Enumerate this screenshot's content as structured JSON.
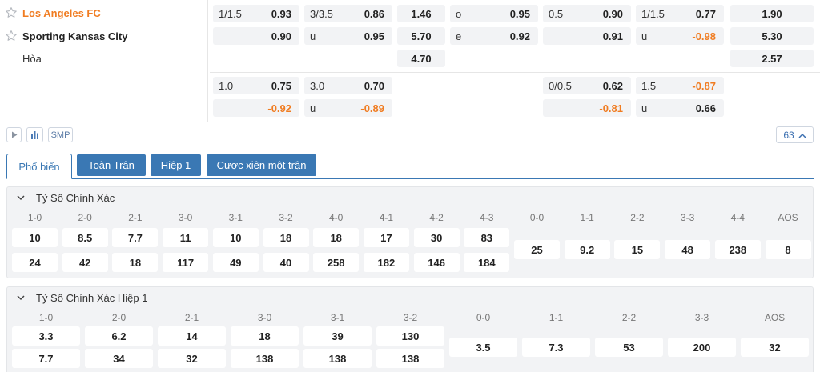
{
  "match": {
    "home": "Los Angeles FC",
    "away": "Sporting Kansas City",
    "draw": "Hòa"
  },
  "odds": {
    "ft_handicap": {
      "line": "1/1.5",
      "home": "0.93",
      "away": "0.90"
    },
    "ft_ou": {
      "line": "3/3.5",
      "over": "0.86",
      "under_label": "u",
      "under": "0.95"
    },
    "ft_1x2": {
      "home": "1.46",
      "away": "5.70",
      "draw": "4.70"
    },
    "ft_oe": {
      "odd_label": "o",
      "odd": "0.95",
      "even_label": "e",
      "even": "0.92"
    },
    "h1_handicap": {
      "line": "0.5",
      "home": "0.90",
      "away": "0.91"
    },
    "h1_ou": {
      "line": "1/1.5",
      "over": "0.77",
      "under_label": "u",
      "under": "-0.98"
    },
    "h1_1x2": {
      "home": "1.90",
      "away": "5.30",
      "draw": "2.57"
    },
    "ft_handicap_2": {
      "line": "1.0",
      "home": "0.75",
      "away": "-0.92"
    },
    "ft_ou_2": {
      "line": "3.0",
      "over": "0.70",
      "under_label": "u",
      "under": "-0.89"
    },
    "h1_handicap_2": {
      "line": "0/0.5",
      "home": "0.62",
      "away": "-0.81"
    },
    "h1_ou_2": {
      "line": "1.5",
      "over": "-0.87",
      "under_label": "u",
      "under": "0.66"
    }
  },
  "toolbar": {
    "smp_label": "SMP",
    "count": "63"
  },
  "tabs": [
    "Phổ biến",
    "Toàn Trận",
    "Hiệp 1",
    "Cược xiên một trận"
  ],
  "correct_score": {
    "title": "Tỷ Số Chính Xác",
    "home_cols": [
      {
        "label": "1-0",
        "home": "10",
        "away": "24"
      },
      {
        "label": "2-0",
        "home": "8.5",
        "away": "42"
      },
      {
        "label": "2-1",
        "home": "7.7",
        "away": "18"
      },
      {
        "label": "3-0",
        "home": "11",
        "away": "117"
      },
      {
        "label": "3-1",
        "home": "10",
        "away": "49"
      },
      {
        "label": "3-2",
        "home": "18",
        "away": "40"
      },
      {
        "label": "4-0",
        "home": "18",
        "away": "258"
      },
      {
        "label": "4-1",
        "home": "17",
        "away": "182"
      },
      {
        "label": "4-2",
        "home": "30",
        "away": "146"
      },
      {
        "label": "4-3",
        "home": "83",
        "away": "184"
      }
    ],
    "draw_cols": [
      {
        "label": "0-0",
        "value": "25"
      },
      {
        "label": "1-1",
        "value": "9.2"
      },
      {
        "label": "2-2",
        "value": "15"
      },
      {
        "label": "3-3",
        "value": "48"
      },
      {
        "label": "4-4",
        "value": "238"
      },
      {
        "label": "AOS",
        "value": "8"
      }
    ]
  },
  "correct_score_h1": {
    "title": "Tỷ Số Chính Xác Hiệp 1",
    "home_cols": [
      {
        "label": "1-0",
        "home": "3.3",
        "away": "7.7"
      },
      {
        "label": "2-0",
        "home": "6.2",
        "away": "34"
      },
      {
        "label": "2-1",
        "home": "14",
        "away": "32"
      },
      {
        "label": "3-0",
        "home": "18",
        "away": "138"
      },
      {
        "label": "3-1",
        "home": "39",
        "away": "138"
      },
      {
        "label": "3-2",
        "home": "130",
        "away": "138"
      }
    ],
    "draw_cols": [
      {
        "label": "0-0",
        "value": "3.5"
      },
      {
        "label": "1-1",
        "value": "7.3"
      },
      {
        "label": "2-2",
        "value": "53"
      },
      {
        "label": "3-3",
        "value": "200"
      },
      {
        "label": "AOS",
        "value": "32"
      }
    ]
  },
  "colors": {
    "accent": "#3a78b4",
    "highlight": "#f07c21",
    "cell_bg": "#f2f3f5"
  }
}
